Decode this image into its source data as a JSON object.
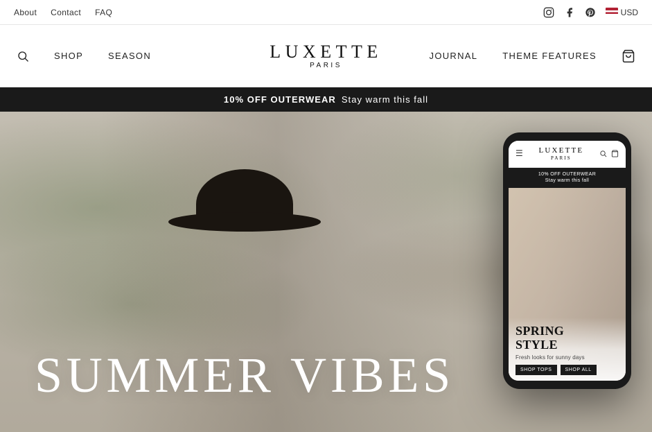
{
  "utility": {
    "links": [
      {
        "id": "about",
        "label": "About"
      },
      {
        "id": "contact",
        "label": "Contact"
      },
      {
        "id": "faq",
        "label": "FAQ"
      }
    ],
    "social": [
      {
        "id": "instagram",
        "symbol": "IG"
      },
      {
        "id": "facebook",
        "symbol": "f"
      },
      {
        "id": "pinterest",
        "symbol": "P"
      }
    ],
    "currency": "USD"
  },
  "nav": {
    "links_left": [
      {
        "id": "shop",
        "label": "SHOP"
      },
      {
        "id": "season",
        "label": "SEASON"
      }
    ],
    "brand_name": "LUXETTE",
    "brand_sub": "PARIS",
    "links_right": [
      {
        "id": "journal",
        "label": "JOURNAL"
      },
      {
        "id": "theme-features",
        "label": "THEME FEATURES"
      }
    ]
  },
  "promo_banner": {
    "bold": "10% OFF OUTERWEAR",
    "text": "Stay warm this fall"
  },
  "hero": {
    "headline": "SUMMER VIBES"
  },
  "phone": {
    "nav": {
      "brand": "LUXETTE",
      "brand_sub": "PARIS"
    },
    "promo": {
      "line1": "10% OFF OUTERWEAR",
      "line2": "Stay warm this fall"
    },
    "hero_title_line1": "SPRING",
    "hero_title_line2": "STYLE",
    "hero_sub": "Fresh looks for sunny days",
    "btn1": "SHOP TOPS",
    "btn2": "SHOP ALL"
  }
}
